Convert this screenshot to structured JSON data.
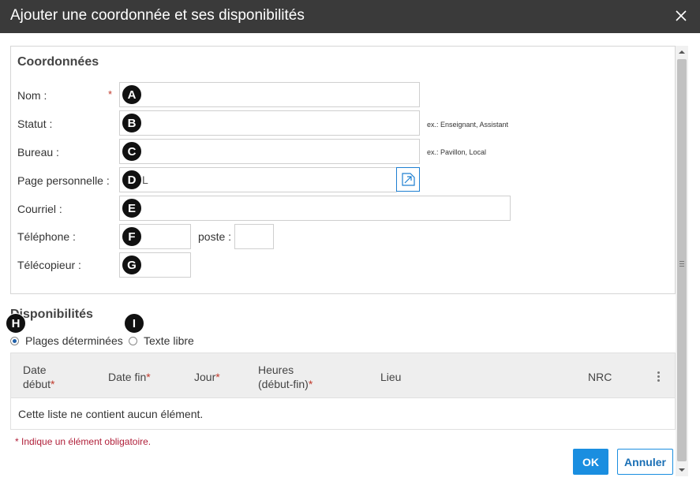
{
  "dialog": {
    "title": "Ajouter une coordonnée et ses disponibilités"
  },
  "coordonnees": {
    "section_title": "Coordonnées",
    "required_marker": "*",
    "fields": {
      "nom": {
        "label": "Nom :",
        "value": "",
        "badge": "A"
      },
      "statut": {
        "label": "Statut :",
        "value": "",
        "badge": "B",
        "hint": "ex.: Enseignant, Assistant"
      },
      "bureau": {
        "label": "Bureau :",
        "value": "",
        "badge": "C",
        "hint": "ex.: Pavillon, Local"
      },
      "page_personnelle": {
        "label": "Page personnelle :",
        "value": "L",
        "badge": "D"
      },
      "courriel": {
        "label": "Courriel :",
        "value": "",
        "badge": "E"
      },
      "telephone": {
        "label": "Téléphone :",
        "value": "",
        "badge": "F"
      },
      "poste": {
        "label": "poste :",
        "value": ""
      },
      "telecopieur": {
        "label": "Télécopieur :",
        "value": "",
        "badge": "G"
      }
    }
  },
  "disponibilites": {
    "section_title": "Disponibilités",
    "badge_h": "H",
    "badge_i": "I",
    "options": [
      {
        "label": "Plages déterminées",
        "checked": true
      },
      {
        "label": "Texte libre",
        "checked": false
      }
    ],
    "columns": {
      "date_debut_line1": "Date",
      "date_debut_line2": "début",
      "date_fin": "Date fin",
      "jour": "Jour",
      "heures_line1": "Heures",
      "heures_line2": "(début-fin)",
      "lieu": "Lieu",
      "nrc": "NRC",
      "star": "*"
    },
    "empty_message": "Cette liste ne contient aucun élément."
  },
  "footnote": "* Indique un élément obligatoire.",
  "buttons": {
    "ok": "OK",
    "cancel": "Annuler"
  },
  "colors": {
    "titlebar": "#3a3a3a",
    "primary": "#1a8ee0",
    "required": "#c0392b"
  }
}
